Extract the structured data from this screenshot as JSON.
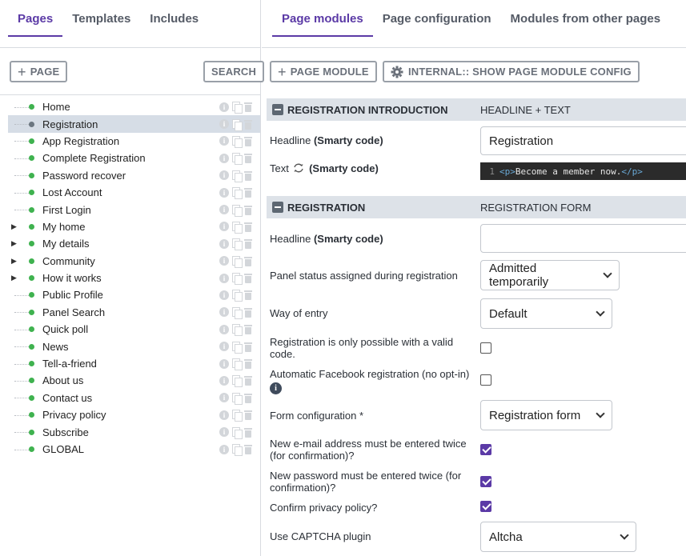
{
  "left": {
    "tabs": [
      {
        "label": "Pages",
        "active": true
      },
      {
        "label": "Templates"
      },
      {
        "label": "Includes"
      }
    ],
    "add_page_label": "PAGE",
    "search_label": "SEARCH",
    "pages": [
      {
        "label": "Home"
      },
      {
        "label": "Registration",
        "selected": true
      },
      {
        "label": "App Registration"
      },
      {
        "label": "Complete Registration"
      },
      {
        "label": "Password recover"
      },
      {
        "label": "Lost Account"
      },
      {
        "label": "First Login"
      },
      {
        "label": "My home",
        "expandable": true
      },
      {
        "label": "My details",
        "expandable": true
      },
      {
        "label": "Community",
        "expandable": true
      },
      {
        "label": "How it works",
        "expandable": true
      },
      {
        "label": "Public Profile"
      },
      {
        "label": "Panel Search"
      },
      {
        "label": "Quick poll"
      },
      {
        "label": "News"
      },
      {
        "label": "Tell-a-friend"
      },
      {
        "label": "About us"
      },
      {
        "label": "Contact us"
      },
      {
        "label": "Privacy policy"
      },
      {
        "label": "Subscribe"
      },
      {
        "label": "GLOBAL"
      }
    ]
  },
  "right": {
    "tabs": [
      {
        "label": "Page modules",
        "active": true
      },
      {
        "label": "Page configuration"
      },
      {
        "label": "Modules from other pages"
      }
    ],
    "add_module_label": "PAGE MODULE",
    "internal_label": "INTERNAL:: SHOW PAGE MODULE CONFIG",
    "section1": {
      "title": "REGISTRATION INTRODUCTION",
      "type": "HEADLINE + TEXT",
      "headline_label": "Headline",
      "headline_suffix": "(Smarty code)",
      "headline_value": "Registration",
      "text_label": "Text",
      "text_suffix": "(Smarty code)",
      "code_line": "1",
      "code_open": "<p>",
      "code_text": "Become a member now.",
      "code_close": "</p>"
    },
    "section2": {
      "title": "REGISTRATION",
      "type": "REGISTRATION FORM",
      "headline_label": "Headline",
      "headline_suffix": "(Smarty code)",
      "headline_value": "",
      "panel_status_label": "Panel status assigned during registration",
      "panel_status_value": "Admitted temporarily",
      "way_of_entry_label": "Way of entry",
      "way_of_entry_value": "Default",
      "valid_code_label": "Registration is only possible with a valid code.",
      "valid_code_checked": false,
      "facebook_label": "Automatic Facebook registration (no opt-in)",
      "facebook_checked": false,
      "form_config_label": "Form configuration *",
      "form_config_value": "Registration form",
      "email_twice_label": "New e-mail address must be entered twice (for confirmation)?",
      "email_twice_checked": true,
      "password_twice_label": "New password must be entered twice (for confirmation)?",
      "password_twice_checked": true,
      "privacy_label": "Confirm privacy policy?",
      "privacy_checked": true,
      "captcha_label": "Use CAPTCHA plugin",
      "captcha_value": "Altcha"
    }
  },
  "colors": {
    "accent": "#5b3aa6",
    "page_dot": "#3fb24f",
    "section_bg": "#dde2e8"
  }
}
